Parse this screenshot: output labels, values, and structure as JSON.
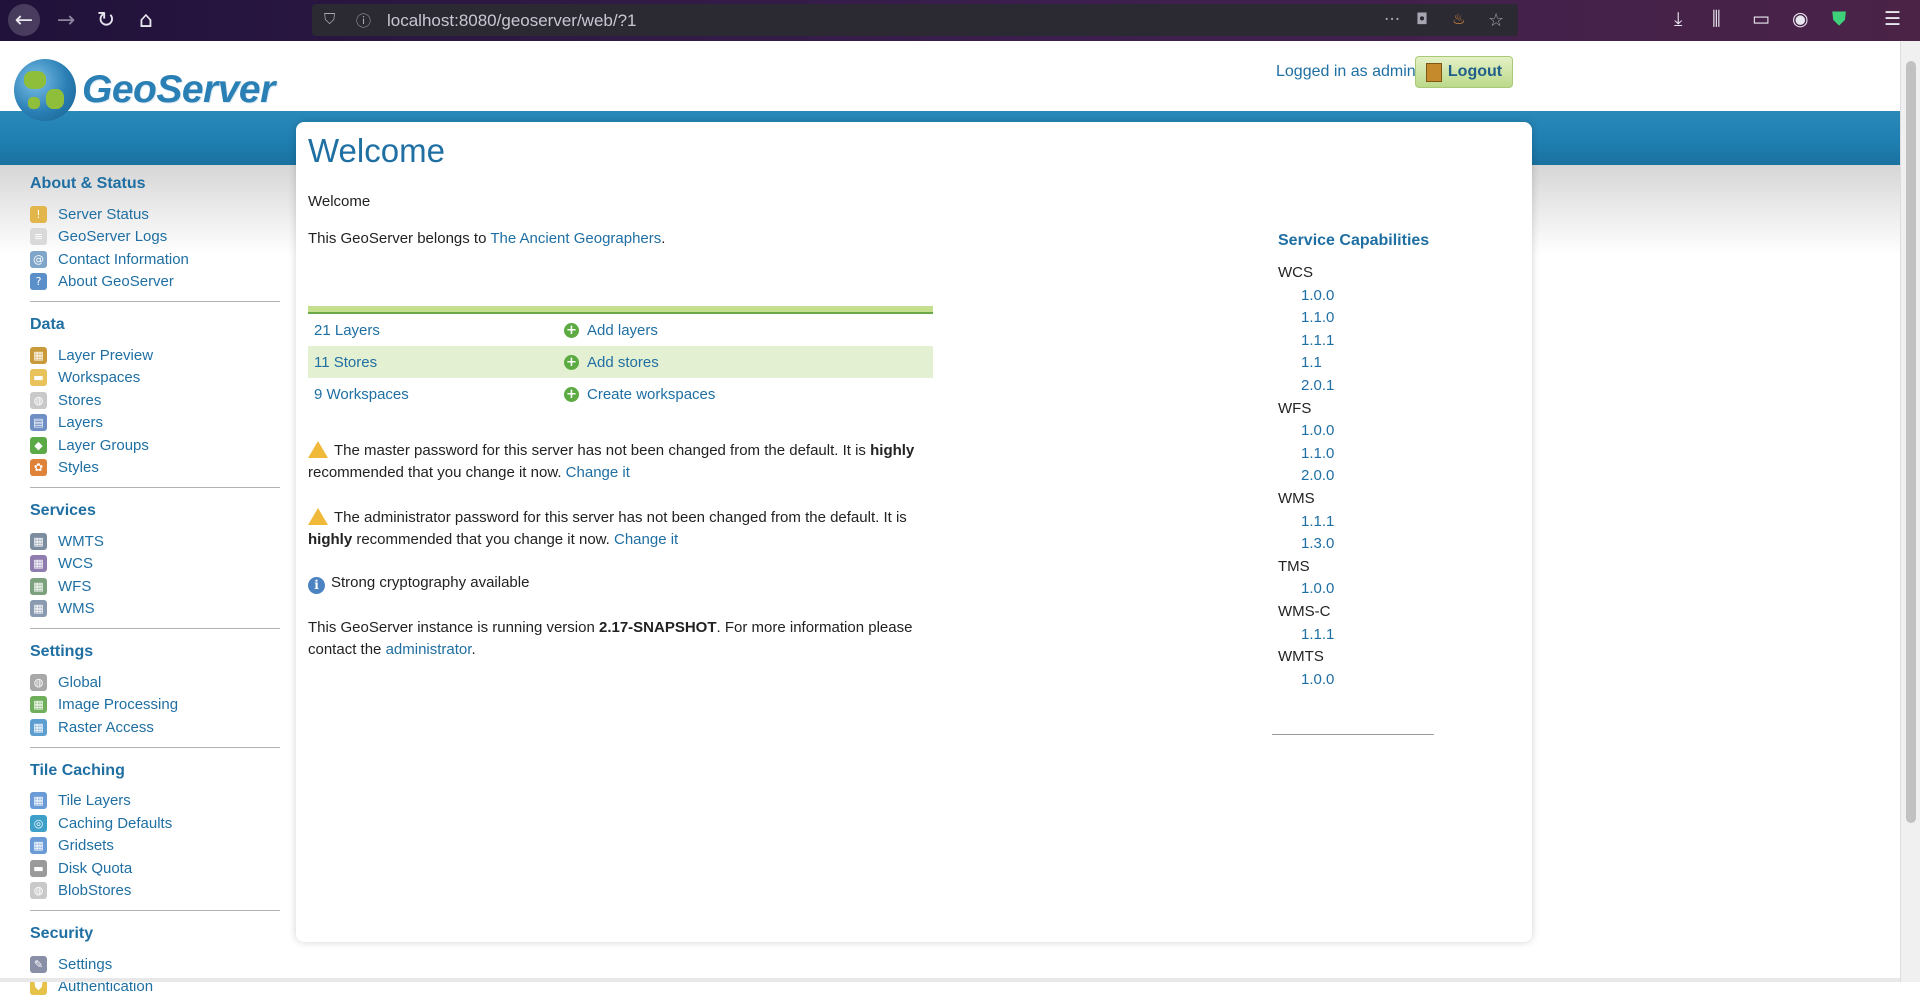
{
  "browser": {
    "url": "localhost:8080/geoserver/web/?1"
  },
  "header": {
    "logo_text": "GeoServer",
    "login_text": "Logged in as admin.",
    "logout_label": "Logout"
  },
  "sidebar": {
    "sections": [
      {
        "title": "About & Status",
        "items": [
          "Server Status",
          "GeoServer Logs",
          "Contact Information",
          "About GeoServer"
        ]
      },
      {
        "title": "Data",
        "items": [
          "Layer Preview",
          "Workspaces",
          "Stores",
          "Layers",
          "Layer Groups",
          "Styles"
        ]
      },
      {
        "title": "Services",
        "items": [
          "WMTS",
          "WCS",
          "WFS",
          "WMS"
        ]
      },
      {
        "title": "Settings",
        "items": [
          "Global",
          "Image Processing",
          "Raster Access"
        ]
      },
      {
        "title": "Tile Caching",
        "items": [
          "Tile Layers",
          "Caching Defaults",
          "Gridsets",
          "Disk Quota",
          "BlobStores"
        ]
      },
      {
        "title": "Security",
        "items": [
          "Settings",
          "Authentication"
        ]
      }
    ]
  },
  "main": {
    "title": "Welcome",
    "subtitle": "Welcome",
    "belongs_prefix": "This GeoServer belongs to ",
    "belongs_link": "The Ancient Geographers",
    "belongs_suffix": ".",
    "stats": [
      {
        "count": "21 Layers",
        "action": "Add layers"
      },
      {
        "count": "11 Stores",
        "action": "Add stores"
      },
      {
        "count": "9 Workspaces",
        "action": "Create workspaces"
      }
    ],
    "master_warning": {
      "part1": "The master password for this server has not been changed from the default. It is ",
      "bold": "highly",
      "part2": " recommended that you change it now. ",
      "link": "Change it"
    },
    "admin_warning": {
      "part1": "The administrator password for this server has not been changed from the default. It is ",
      "bold": "highly",
      "part2": " recommended that you change it now. ",
      "link": "Change it"
    },
    "crypto_text": "Strong cryptography available",
    "version": {
      "prefix": "This GeoServer instance is running version ",
      "version": "2.17-SNAPSHOT",
      "middle": ". For more information please contact the ",
      "link": "administrator",
      "suffix": "."
    }
  },
  "capabilities": {
    "title": "Service Capabilities",
    "services": [
      {
        "name": "WCS",
        "versions": [
          "1.0.0",
          "1.1.0",
          "1.1.1",
          "1.1",
          "2.0.1"
        ]
      },
      {
        "name": "WFS",
        "versions": [
          "1.0.0",
          "1.1.0",
          "2.0.0"
        ]
      },
      {
        "name": "WMS",
        "versions": [
          "1.1.1",
          "1.3.0"
        ]
      },
      {
        "name": "TMS",
        "versions": [
          "1.0.0"
        ]
      },
      {
        "name": "WMS-C",
        "versions": [
          "1.1.1"
        ]
      },
      {
        "name": "WMTS",
        "versions": [
          "1.0.0"
        ]
      }
    ]
  },
  "colors": {
    "link": "#1f6fa3",
    "header_band": "#1e7eb0",
    "stats_accent": "#c4df8e"
  }
}
